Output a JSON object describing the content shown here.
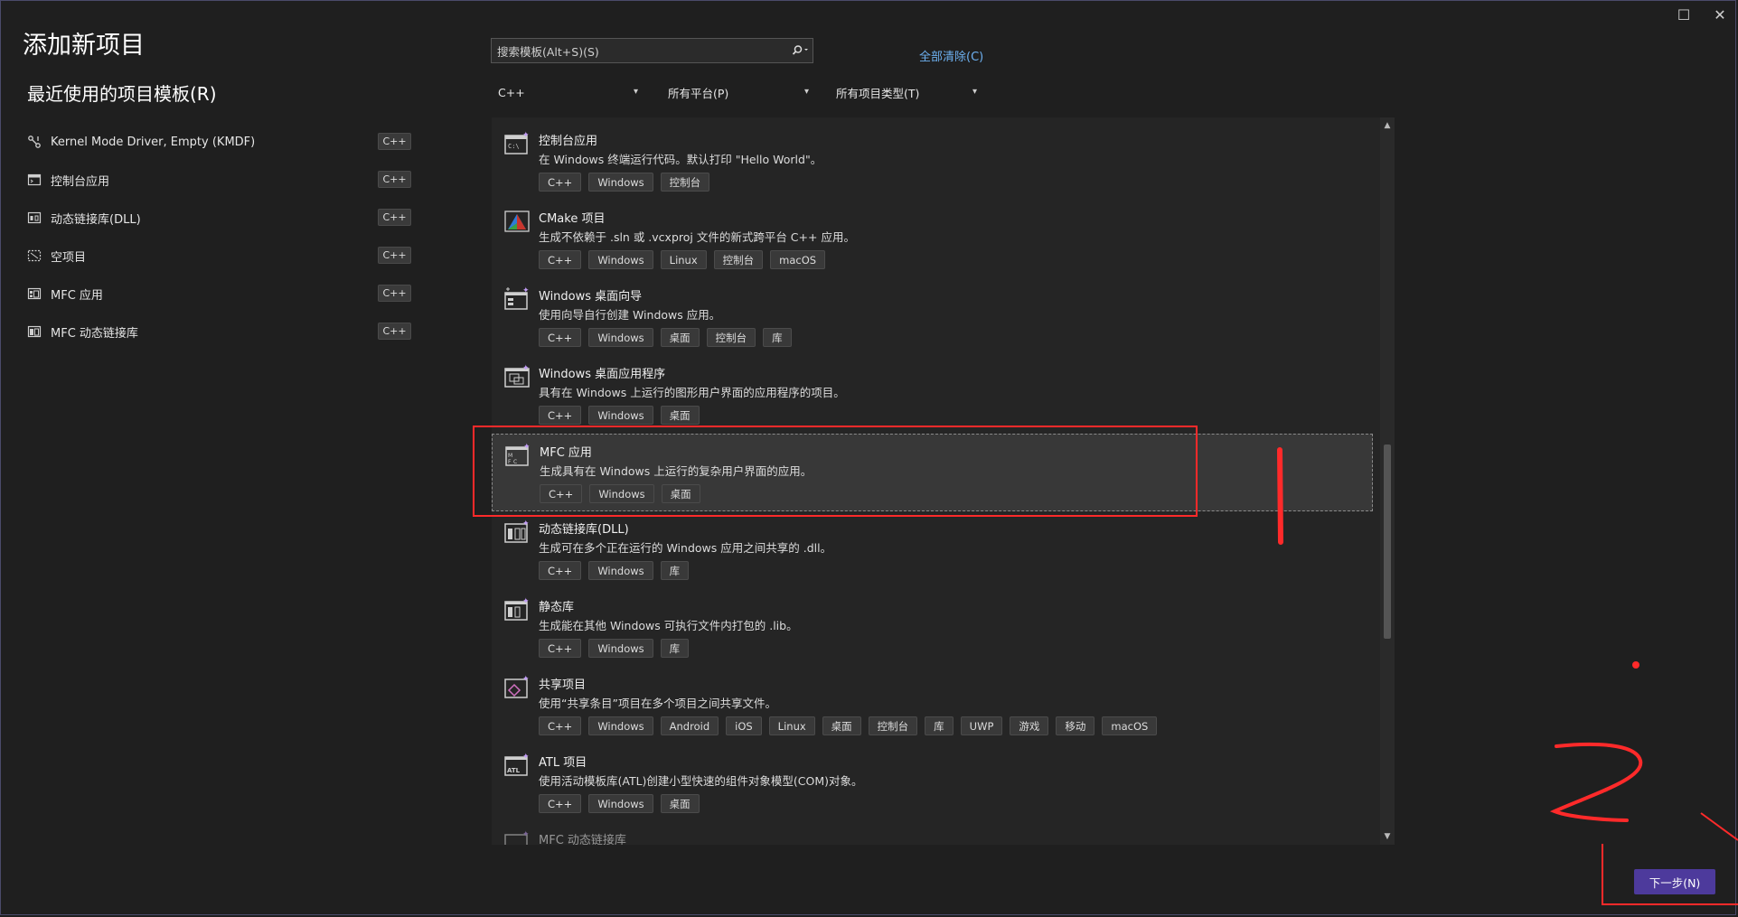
{
  "window": {
    "maximize_glyph": "☐",
    "close_glyph": "✕"
  },
  "title": "添加新项目",
  "recent": {
    "heading": "最近使用的项目模板(R)",
    "items": [
      {
        "name": "Kernel Mode Driver, Empty (KMDF)",
        "tag": "C++",
        "icon": "driver-icon"
      },
      {
        "name": "控制台应用",
        "tag": "C++",
        "icon": "console-icon"
      },
      {
        "name": "动态链接库(DLL)",
        "tag": "C++",
        "icon": "dll-icon"
      },
      {
        "name": "空项目",
        "tag": "C++",
        "icon": "empty-project-icon"
      },
      {
        "name": "MFC 应用",
        "tag": "C++",
        "icon": "mfc-icon"
      },
      {
        "name": "MFC 动态链接库",
        "tag": "C++",
        "icon": "mfc-dll-icon"
      }
    ]
  },
  "search": {
    "placeholder": "搜索模板(Alt+S)(S)",
    "icon": "search-icon"
  },
  "clear_all": "全部清除(C)",
  "filters": {
    "language": "C++",
    "platform": "所有平台(P)",
    "project_type": "所有项目类型(T)"
  },
  "templates": [
    {
      "name": "控制台应用",
      "desc": "在 Windows 终端运行代码。默认打印 \"Hello World\"。",
      "tags": [
        "C++",
        "Windows",
        "控制台"
      ],
      "icon": "console-app-icon"
    },
    {
      "name": "CMake 项目",
      "desc": "生成不依赖于 .sln 或 .vcxproj 文件的新式跨平台 C++ 应用。",
      "tags": [
        "C++",
        "Windows",
        "Linux",
        "控制台",
        "macOS"
      ],
      "icon": "cmake-icon"
    },
    {
      "name": "Windows 桌面向导",
      "desc": "使用向导自行创建 Windows 应用。",
      "tags": [
        "C++",
        "Windows",
        "桌面",
        "控制台",
        "库"
      ],
      "icon": "wizard-icon"
    },
    {
      "name": "Windows 桌面应用程序",
      "desc": "具有在 Windows 上运行的图形用户界面的应用程序的项目。",
      "tags": [
        "C++",
        "Windows",
        "桌面"
      ],
      "icon": "desktop-app-icon"
    },
    {
      "name": "MFC 应用",
      "desc": "生成具有在 Windows 上运行的复杂用户界面的应用。",
      "tags": [
        "C++",
        "Windows",
        "桌面"
      ],
      "icon": "mfc-app-icon",
      "selected": true
    },
    {
      "name": "动态链接库(DLL)",
      "desc": "生成可在多个正在运行的 Windows 应用之间共享的 .dll。",
      "tags": [
        "C++",
        "Windows",
        "库"
      ],
      "icon": "dll-template-icon"
    },
    {
      "name": "静态库",
      "desc": "生成能在其他 Windows 可执行文件内打包的 .lib。",
      "tags": [
        "C++",
        "Windows",
        "库"
      ],
      "icon": "static-lib-icon"
    },
    {
      "name": "共享项目",
      "desc": "使用“共享条目”项目在多个项目之间共享文件。",
      "tags": [
        "C++",
        "Windows",
        "Android",
        "iOS",
        "Linux",
        "桌面",
        "控制台",
        "库",
        "UWP",
        "游戏",
        "移动",
        "macOS"
      ],
      "icon": "shared-project-icon"
    },
    {
      "name": "ATL 项目",
      "desc": "使用活动模板库(ATL)创建小型快速的组件对象模型(COM)对象。",
      "tags": [
        "C++",
        "Windows",
        "桌面"
      ],
      "icon": "atl-icon"
    },
    {
      "name": "MFC 动态链接库",
      "desc": "",
      "tags": [],
      "icon": "mfc-dll-template-icon"
    }
  ],
  "next_button": "下一步(N)",
  "annotations": {
    "mark_1": "1",
    "mark_2": "2",
    "color": "#ff2a2a"
  }
}
